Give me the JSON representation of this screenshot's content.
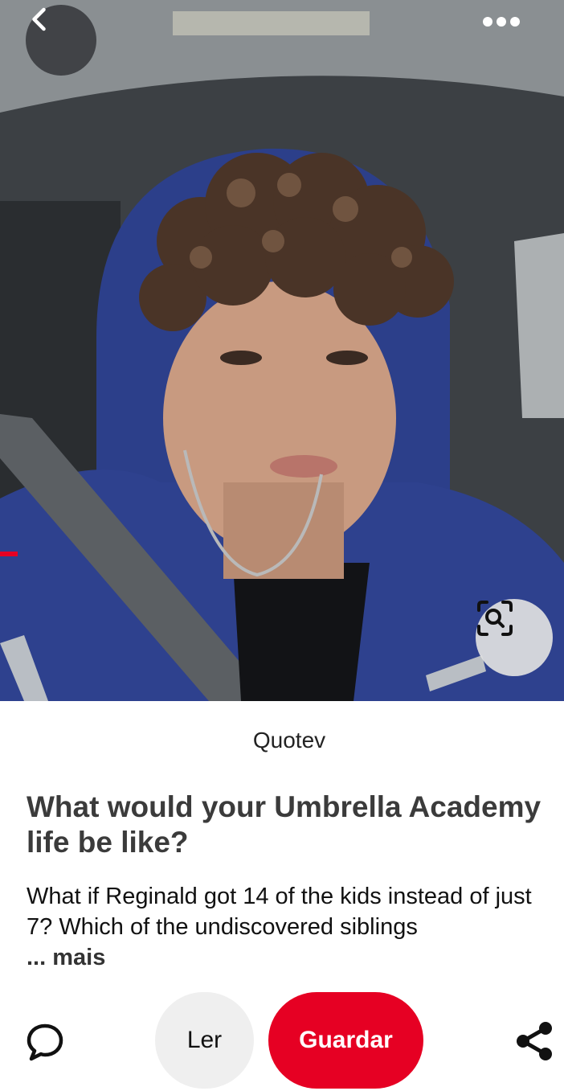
{
  "pin": {
    "image_alt": "Selfie of a teen with curly hair wearing a blue hooded jacket inside a car",
    "source": "Quotev",
    "title": "What would your Umbrella Academy life be like?",
    "description": "What if Reginald got 14 of the kids instead of just 7? Which of the undiscovered siblings",
    "more_label": "... mais"
  },
  "toolbar": {
    "back_icon": "chevron-left-icon",
    "more_icon": "ellipsis-icon",
    "lens_icon": "visual-search-icon"
  },
  "actions": {
    "comment_icon": "comment-bubble-icon",
    "read_label": "Ler",
    "save_label": "Guardar",
    "share_icon": "share-icon"
  },
  "colors": {
    "save_red": "#e60023",
    "read_gray": "#efefef"
  }
}
